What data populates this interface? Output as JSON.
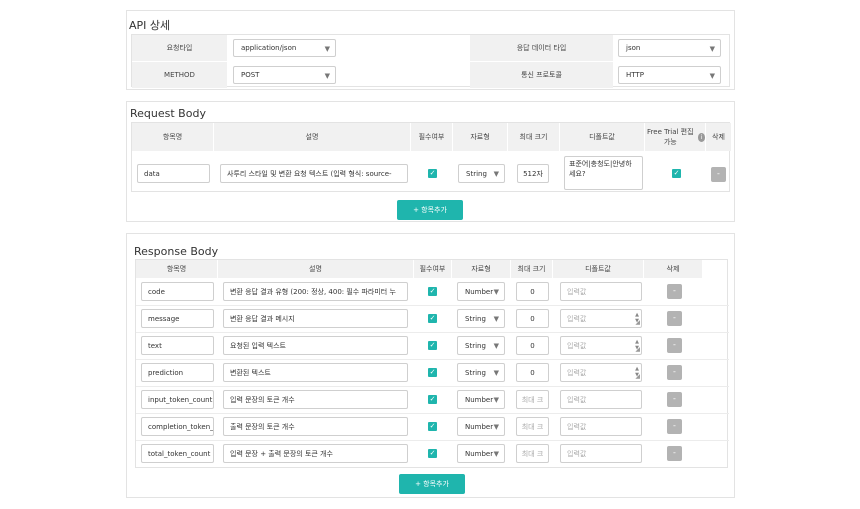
{
  "api": {
    "title": "API 상세",
    "request_type_label": "요청타입",
    "request_type_value": "application/json",
    "response_type_label": "응답 데이터 타입",
    "response_type_value": "json",
    "method_label": "METHOD",
    "method_value": "POST",
    "protocol_label": "통신 프로토콜",
    "protocol_value": "HTTP"
  },
  "request": {
    "title": "Request Body",
    "headers": [
      "항목명",
      "설명",
      "필수여부",
      "자료형",
      "최대 크기",
      "디폴트값",
      "Free Trial 편집 가능",
      "삭제"
    ],
    "row": {
      "name": "data",
      "desc": "사투리 스타일 및 변환 요청 텍스트 (입력 형식: source-",
      "type": "String",
      "max": "512자",
      "default": "표준어|충청도|안녕하세요?",
      "delete": "-"
    },
    "add_label": "+ 항목추가"
  },
  "response": {
    "title": "Response Body",
    "headers": [
      "항목명",
      "설명",
      "필수여부",
      "자료형",
      "최대 크기",
      "디폴트값",
      "삭제"
    ],
    "rows": [
      {
        "name": "code",
        "desc": "변환 응답 결과 유형 (200: 정상, 400: 필수 파라미터 누",
        "type": "Number",
        "max": "0",
        "default": "입력값",
        "delete": "-"
      },
      {
        "name": "message",
        "desc": "변환 응답 결과 메시지",
        "type": "String",
        "max": "0",
        "default": "입력값",
        "delete": "-"
      },
      {
        "name": "text",
        "desc": "요청된 입력 텍스트",
        "type": "String",
        "max": "0",
        "default": "입력값",
        "delete": "-"
      },
      {
        "name": "prediction",
        "desc": "변환된 텍스트",
        "type": "String",
        "max": "0",
        "default": "입력값",
        "delete": "-"
      },
      {
        "name": "input_token_count",
        "desc": "입력 문장의 토큰 개수",
        "type": "Number",
        "max": "최대 크",
        "default": "입력값",
        "delete": "-"
      },
      {
        "name": "completion_token_",
        "desc": "출력 문장의 토큰 개수",
        "type": "Number",
        "max": "최대 크",
        "default": "입력값",
        "delete": "-"
      },
      {
        "name": "total_token_count",
        "desc": "입력 문장 + 출력 문장의 토큰 개수",
        "type": "Number",
        "max": "최대 크",
        "default": "입력값",
        "delete": "-"
      }
    ],
    "add_label": "+ 항목추가"
  },
  "colors": {
    "accent": "#1fb5ad",
    "header_bg": "#f1f1f1",
    "delete_bg": "#b3b3b3"
  }
}
